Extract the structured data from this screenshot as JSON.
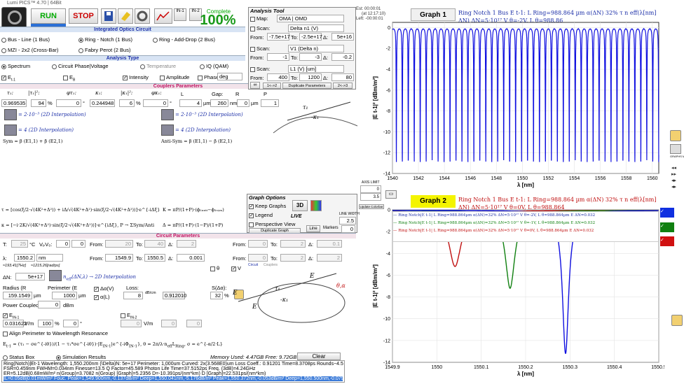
{
  "window": {
    "title": "Lumi PICS™ 4.70 | 64Bit"
  },
  "toolbar": {
    "run": "RUN",
    "stop": "STOP",
    "complete_label": "Complete",
    "complete_pct": "100%"
  },
  "timer": {
    "est_label": "Est:",
    "est": "00:00:01",
    "date": "(at 12:17:10)",
    "left_label": "Left:",
    "left": "-00:00:01"
  },
  "sections": {
    "integrated": "Integrated Optics Circuit",
    "analysis": "Analysis Type",
    "couplers": "Couplers Parameters",
    "circuit": "Circuit Parameters"
  },
  "circuits": [
    "Bus - Line (1 Bus)",
    "Ring - Notch (1 Bus)",
    "Ring - Add-Drop (2 Bus)",
    "MZI - 2x2 (Cross-Bar)",
    "Fabry Perot (2 Bus)"
  ],
  "analysis_types": [
    "Spectrum",
    "Circuit Phase|Voltage",
    "Temperature",
    "IQ (QAM)"
  ],
  "fields": {
    "et1": "E",
    "eb": "E",
    "intensity": "Intensity",
    "amplitude": "Amplitude",
    "phase": "Phase",
    "deg": "deg"
  },
  "coupler": {
    "tau1": "0.969535",
    "tau1sq": "94",
    "phi_tau": "0",
    "kappa1": "0.244948",
    "kappa1sq": "6",
    "phi_k": "0",
    "lparallel": "4",
    "gap": "260",
    "rcurved": "0",
    "pratio": "1",
    "um": "µm",
    "nm": "nm",
    "pct": "%",
    "deg": "°",
    "lpar_label": "L",
    "gap_label": "Gap:",
    "rcurved_label": "R",
    "pratio_label": "P"
  },
  "interp": {
    "w": "= 2·10⁻³ (2D Interpolation)",
    "n": "= 4 (2D Interpolation)",
    "sym": "Sym",
    "antisym": "Anti-Sym"
  },
  "analysis_tool": {
    "title": "Analysis Tool",
    "map": "Map:",
    "map_value": "OMA | OMD",
    "scan": "Scan:",
    "scan1": "Delta n1 (V)",
    "from": "From:",
    "to": "To:",
    "delta": "Δ:",
    "from1": "-7.5e+17",
    "to1": "-2.5e+17",
    "d1": "5e+16",
    "scan2": "V1 (Delta n)",
    "from2": "-1",
    "to2": "-3",
    "d2": "-0.2",
    "scan3": "L1 (V) [um]",
    "from3": "400",
    "to3": "1200",
    "d3": "80",
    "btn1": "1<->2",
    "btn2": "Duplicate Parameters",
    "btn3": "2<->3"
  },
  "graph_opts": {
    "title": "Graph Options",
    "keep": "Keep Graphs",
    "legend": "Legend",
    "persp": "Perspective View",
    "dup": "Duplicate Graph",
    "live": "LIVE",
    "line": "Line",
    "markers": "Markers",
    "axis_limit": "AXIS LIMIT",
    "line_width": "LINE WIDTH",
    "lw": "2.5",
    "update": "Update Colorbar",
    "threeD": "3D",
    "ax1": "0",
    "ax2": "3.5",
    "ax3": "0"
  },
  "circuit": {
    "T": "T:",
    "T_val": "25",
    "T_unit": "°C",
    "vpv": "VₚV₀:",
    "v1": "0",
    "v2": "0",
    "from": "From:",
    "to": "To:",
    "d": "Δ:",
    "f1": "20",
    "t1": "40",
    "d1": "2",
    "f2": "0",
    "t2": "2",
    "d2": "0.1",
    "f3": "0",
    "t3": "2",
    "d3": "2",
    "lambda": "λ:",
    "lambda_val": "1550.2",
    "lambda_unit": "nm",
    "thz": "≈193.41[THz]",
    "rad": "≈1215.26[rad/ps]",
    "lf": "1549.9",
    "lt": "1550.5",
    "ld": "0.001",
    "theta": "θ",
    "V": "V",
    "circ_lbl": "Circuit",
    "coup_lbl": "Couplers",
    "dn_label": "ΔN:",
    "dn": "5e+17",
    "dn_interp": "(ΔN,λ) → 2D Interpolation",
    "radius_label": "Radius (R",
    "radius": "159.1549",
    "per_label": "Perimeter (E",
    "per": "1000",
    "loss_label": "Loss:",
    "loss": "8",
    "loss_unit": "dB/cm",
    "sigma": "0.912010",
    "sdn": "32",
    "pc_label": "Power Coupled:",
    "pc": "0",
    "pc_unit": "dBm",
    "ein": "0.031622",
    "ein_unit": "V/m",
    "ein_pct": "100",
    "ein_deg": "0",
    "ein1b": "0",
    "ein1b_u": "V/m",
    "ein1b_pct": "0",
    "ein1b_deg": "0",
    "align": "Align Perimeter to Wavelength Resonance"
  },
  "status": {
    "box": "Status Box",
    "sim": "Simulation Results",
    "mem": "Memory Used: 4.47GB  Free: 9.72GB",
    "clear": "Clear",
    "lines": [
      "Ring(Notch)|Et-1   Wavelength: 1,550.200nm   (\\Delta)N: 5e+17  Perimeter: 1,000um  Curved: 2x(3.568E0)um  Loss Coeff.: 0.91201  Time=8.3708ps  Rounds~4.5",
      "FSR=0.459nm     FWHM=0.034nm     Finesse=13.5   Q Factor=45.589   Photon Life Time=37.5152ps   Freq. (3dB)=4.24GHz",
      "ER=5.12dB|0.68mW/m²    n(Group)=3.7082    n(Group) [Graph]=5.2356    D=-10.391ps/(nm*km)    D [Graph]=22.531ps/(nm*km)",
      "IL=0.05dB|0.01mW/m²    Fouc. Peak=1,549.900nm,-0.137dB/m²  Deep=1,550.041nm,-5.176dB/m²  Peak=1,550.372nm,-0.053dB/m²  Deep=1,550.500nm,-0.079dB/m²"
    ]
  },
  "graph1": {
    "label": "Graph 1",
    "heading": "Ring Notch 1 Bus  E t-1: L Ring=988.864 µm  α(ΔN) 32%  τ  n eff(λ[nm] ΔN)  ΔN=5·10¹⁷  V θ=-2V, L θ=988.86"
  },
  "graph2": {
    "label": "Graph 2",
    "heading": "Ring Notch 1 Bus  E t-1: L Ring=988.864 µm  α(ΔN) 32%  τ  n eff(λ[nm] ΔN)  ΔN=5·10¹⁷  V θ=0V, L θ=988.864"
  },
  "graph2_legend": [
    "Ring Notch|E t-1| L Ring=988.864µm α(ΔN)=32%  ΔN=5·10¹⁷  V θ=-2V, L θ=988.864µm  E ΔN=0.032",
    "Ring Notch|E t-1| L Ring=988.864µm α(ΔN)=32%  ΔN=5·10¹⁷  V θ=-1V, L θ=988.864µm  E ΔN=0.032",
    "Ring Notch|E t-1| L Ring=988.864µm α(ΔN)=32%  ΔN=5·10¹⁷  V θ=0V, L θ=988.864µm  E ΔN=0.032"
  ],
  "colors": {
    "blue": "#1010e0",
    "green": "#108010",
    "red": "#c01010",
    "titleyellow": "#f4f400"
  },
  "chart_data": [
    {
      "type": "line",
      "title": "Graph 1",
      "xlabel": "λ [nm]",
      "ylabel": "|E t-1|² [dBm/m²]",
      "xlim": [
        1540,
        1560.5
      ],
      "ylim": [
        -14,
        0.5
      ],
      "xticks": [
        1540,
        1542,
        1544,
        1546,
        1548,
        1550,
        1552,
        1554,
        1556,
        1558,
        1560
      ],
      "yticks": [
        0,
        -2,
        -4,
        -6,
        -8,
        -10,
        -12,
        -14
      ],
      "fsr": 0.459,
      "first_dip": 1540.3,
      "dip_depth": -12.9,
      "baseline": -0.05,
      "series": [
        {
          "color": "#1010e0"
        }
      ]
    },
    {
      "type": "line",
      "title": "Graph 2",
      "xlabel": "λ [nm]",
      "ylabel": "|E t-1|² [dBm/m²]",
      "xlim": [
        1549.9,
        1550.5
      ],
      "ylim": [
        -14,
        0
      ],
      "xticks": [
        1549.9,
        1550,
        1550.1,
        1550.2,
        1550.3,
        1550.4,
        1550.5
      ],
      "yticks": [
        0,
        -2,
        -4,
        -6,
        -8,
        -10,
        -12,
        -14
      ],
      "series": [
        {
          "name": "Vθ=-2V",
          "color": "#c01010",
          "dip": 1550.041,
          "depth": -5.2,
          "fwhm": 0.034
        },
        {
          "name": "Vθ=-1V",
          "color": "#108010",
          "dip": 1550.165,
          "depth": -7.2,
          "fwhm": 0.026
        },
        {
          "name": "Vθ=0V",
          "color": "#1010e0",
          "dip": 1550.29,
          "depth": -13.2,
          "fwhm": 0.017
        }
      ]
    }
  ]
}
